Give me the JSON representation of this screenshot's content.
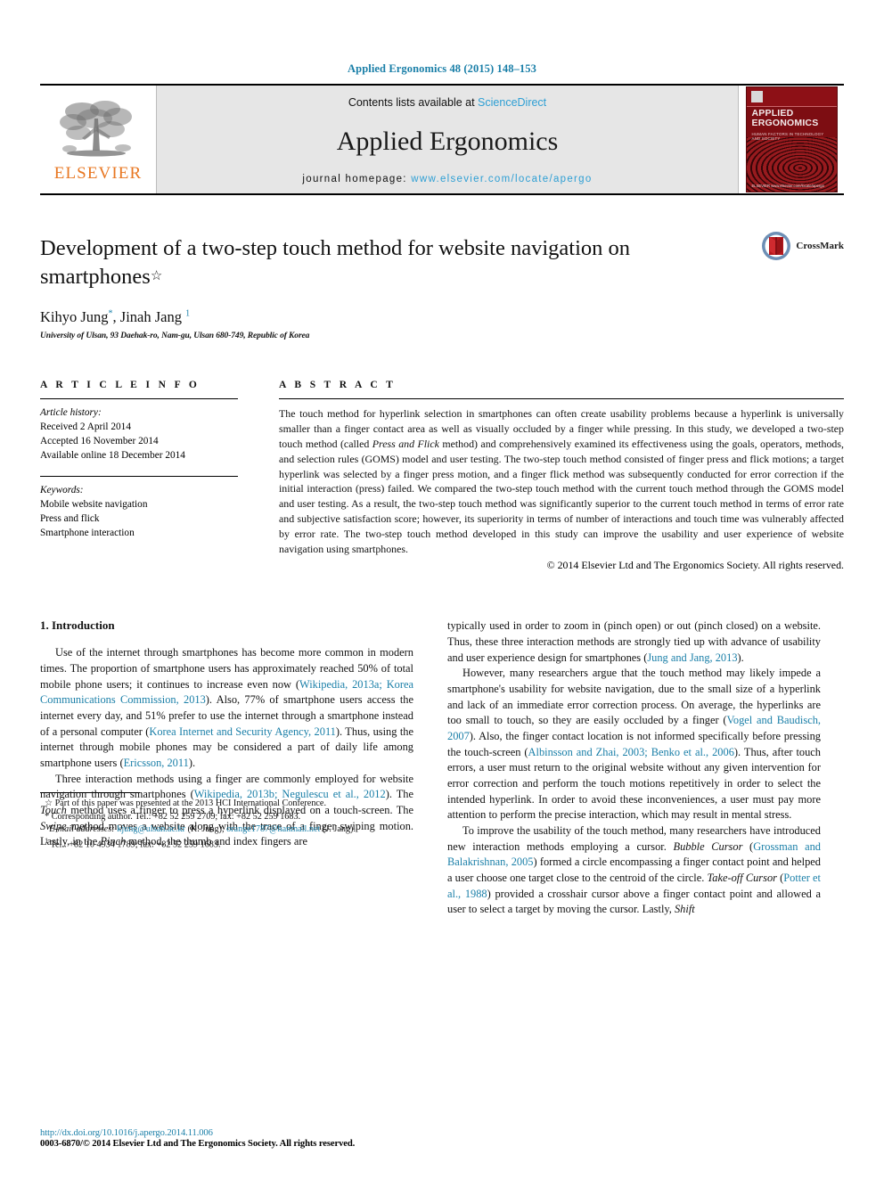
{
  "running_head": "Applied Ergonomics 48 (2015) 148–153",
  "masthead": {
    "publisher_name": "ELSEVIER",
    "contents_prefix": "Contents lists available at ",
    "contents_link": "ScienceDirect",
    "journal_name": "Applied Ergonomics",
    "homepage_prefix": "journal homepage: ",
    "homepage_url": "www.elsevier.com/locate/apergo",
    "cover": {
      "title_line1": "APPLIED",
      "title_line2": "ERGONOMICS",
      "subtitle": "HUMAN FACTORS IN TECHNOLOGY AND SOCIETY",
      "footer": "ELSEVIER\nwww.elsevier.com/locate/apergo"
    }
  },
  "article": {
    "title": "Development of a two-step touch method for website navigation on smartphones",
    "title_footnote_marker": "☆",
    "authors": "Kihyo Jung",
    "author_marker_1": "*",
    "authors_2": ", Jinah Jang",
    "author_marker_2": "1",
    "affiliation": "University of Ulsan, 93 Daehak-ro, Nam-gu, Ulsan 680-749, Republic of Korea",
    "crossmark_label": "CrossMark"
  },
  "article_info": {
    "heading": "A R T I C L E   I N F O",
    "history_label": "Article history:",
    "history": [
      "Received 2 April 2014",
      "Accepted 16 November 2014",
      "Available online 18 December 2014"
    ],
    "keywords_label": "Keywords:",
    "keywords": [
      "Mobile website navigation",
      "Press and flick",
      "Smartphone interaction"
    ]
  },
  "abstract": {
    "heading": "A B S T R A C T",
    "p1a": "The touch method for hyperlink selection in smartphones can often create usability problems because a hyperlink is universally smaller than a finger contact area as well as visually occluded by a finger while pressing. In this study, we developed a two-step touch method (called ",
    "p1_italic": "Press and Flick",
    "p1b": " method) and comprehensively examined its effectiveness using the goals, operators, methods, and selection rules (GOMS) model and user testing. The two-step touch method consisted of finger press and flick motions; a target hyperlink was selected by a finger press motion, and a finger flick method was subsequently conducted for error correction if the initial interaction (press) failed. We compared the two-step touch method with the current touch method through the GOMS model and user testing. As a result, the two-step touch method was significantly superior to the current touch method in terms of error rate and subjective satisfaction score; however, its superiority in terms of number of interactions and touch time was vulnerably affected by error rate. The two-step touch method developed in this study can improve the usability and user experience of website navigation using smartphones.",
    "copyright": "© 2014 Elsevier Ltd and The Ergonomics Society. All rights reserved."
  },
  "body": {
    "section_1_title": "1.  Introduction",
    "left": {
      "p1_a": "Use of the internet through smartphones has become more common in modern times. The proportion of smartphone users has approximately reached 50% of total mobile phone users; it continues to increase even now (",
      "p1_cite1": "Wikipedia, 2013a; Korea Communications Commission, 2013",
      "p1_b": "). Also, 77% of smartphone users access the internet every day, and 51% prefer to use the internet through a smartphone instead of a personal computer (",
      "p1_cite2": "Korea Internet and Security Agency, 2011",
      "p1_c": "). Thus, using the internet through mobile phones may be considered a part of daily life among smartphone users (",
      "p1_cite3": "Ericsson, 2011",
      "p1_d": ").",
      "p2_a": "Three interaction methods using a finger are commonly employed for website navigation through smartphones (",
      "p2_cite1": "Wikipedia, 2013b; Negulescu et al., 2012",
      "p2_b": "). The ",
      "p2_i1": "Touch",
      "p2_c": " method uses a finger to press a hyperlink displayed on a touch-screen. The ",
      "p2_i2": "Swipe",
      "p2_d": " method moves a website along with the trace of a finger swiping motion. Lastly, in the ",
      "p2_i3": "Pinch",
      "p2_e": " method, the thumb and index fingers are"
    },
    "right": {
      "p1_a": "typically used in order to zoom in (pinch open) or out (pinch closed) on a website. Thus, these three interaction methods are strongly tied up with advance of usability and user experience design for smartphones (",
      "p1_cite1": "Jung and Jang, 2013",
      "p1_b": ").",
      "p2_a": "However, many researchers argue that the touch method may likely impede a smartphone's usability for website navigation, due to the small size of a hyperlink and lack of an immediate error correction process. On average, the hyperlinks are too small to touch, so they are easily occluded by a finger (",
      "p2_cite1": "Vogel and Baudisch, 2007",
      "p2_b": "). Also, the finger contact location is not informed specifically before pressing the touch-screen (",
      "p2_cite2": "Albinsson and Zhai, 2003; Benko et al., 2006",
      "p2_c": "). Thus, after touch errors, a user must return to the original website without any given intervention for error correction and perform the touch motions repetitively in order to select the intended hyperlink. In order to avoid these inconveniences, a user must pay more attention to perform the precise interaction, which may result in mental stress.",
      "p3_a": "To improve the usability of the touch method, many researchers have introduced new interaction methods employing a cursor. ",
      "p3_i1": "Bubble Cursor",
      "p3_b": " (",
      "p3_cite1": "Grossman and Balakrishnan, 2005",
      "p3_c": ") formed a circle encompassing a finger contact point and helped a user choose one target close to the centroid of the circle. ",
      "p3_i2": "Take-off Cursor",
      "p3_d": " (",
      "p3_cite2": "Potter et al., 1988",
      "p3_e": ") provided a crosshair cursor above a finger contact point and allowed a user to select a target by moving the cursor. Lastly, ",
      "p3_i3": "Shift"
    }
  },
  "footnotes": {
    "star_marker": "☆",
    "star_text": "Part of this paper was presented at the 2013 HCI International Conference.",
    "corr_marker": "*",
    "corr_text": "Corresponding author. Tel.: +82 52 259 2709; fax: +82 52 259 1683.",
    "email_label": "E-mail addresses:",
    "email_1": "kjung@ulsan.ac.kr",
    "email_1_owner": " (K. Jung), ",
    "email_2": "orange1787@hanmail.net",
    "email_2_owner": " (J. Jang).",
    "fn1_marker": "1",
    "fn1_text": "Tel.: +82 10 4934 1789; fax: +82 52 259 1683."
  },
  "footer": {
    "doi": "http://dx.doi.org/10.1016/j.apergo.2014.11.006",
    "issn_copyright": "0003-6870/© 2014 Elsevier Ltd and The Ergonomics Society. All rights reserved."
  },
  "colors": {
    "link_blue": "#1a7fa8",
    "sciencedirect_blue": "#2e9fd4",
    "elsevier_orange": "#E87722",
    "cover_red": "#7d0d12"
  }
}
